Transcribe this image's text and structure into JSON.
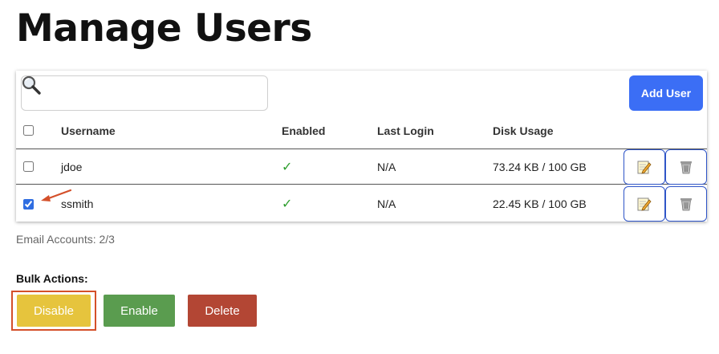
{
  "page": {
    "title": "Manage Users"
  },
  "search": {
    "value": "",
    "placeholder": ""
  },
  "toolbar": {
    "add_user_label": "Add User"
  },
  "table": {
    "columns": [
      "Username",
      "Enabled",
      "Last Login",
      "Disk Usage"
    ],
    "rows": [
      {
        "username": "jdoe",
        "enabled": "✓",
        "last_login": "N/A",
        "disk_usage": "73.24 KB / 100 GB",
        "selected": false
      },
      {
        "username": "ssmith",
        "enabled": "✓",
        "last_login": "N/A",
        "disk_usage": "22.45 KB / 100 GB",
        "selected": true
      }
    ]
  },
  "footer": {
    "accounts": "Email Accounts: 2/3"
  },
  "bulk": {
    "label": "Bulk Actions:",
    "disable_label": "Disable",
    "enable_label": "Enable",
    "delete_label": "Delete"
  },
  "icons": {
    "search": "magnifier-icon",
    "edit": "edit-icon",
    "delete": "trash-icon",
    "annotation": "arrow-icon"
  },
  "colors": {
    "primary": "#3b6ef5",
    "disable": "#e6c43d",
    "enable": "#5a9c4f",
    "delete": "#b34634",
    "highlight": "#d4502a",
    "check": "#2e9e2e"
  }
}
